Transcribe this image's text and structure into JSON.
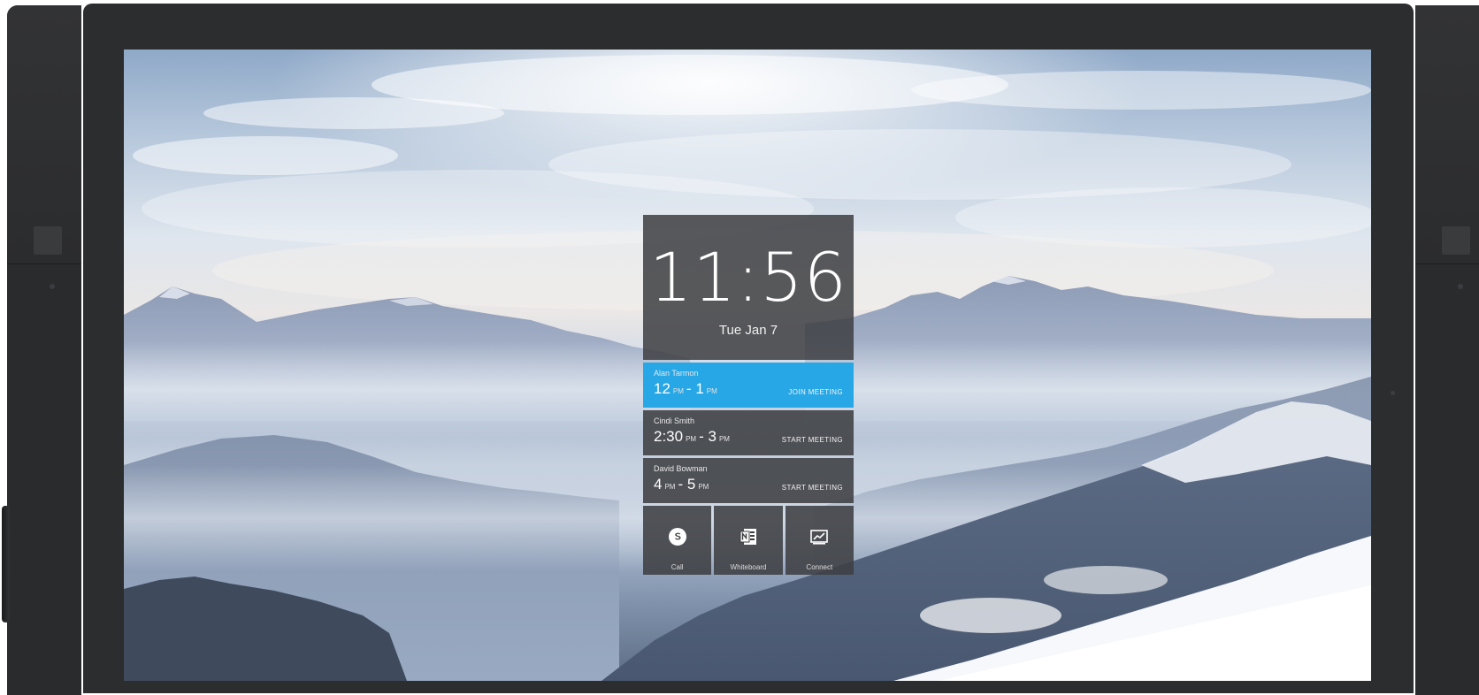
{
  "lockscreen": {
    "time": "11:56",
    "date": "Tue Jan 7"
  },
  "meetings": [
    {
      "organizer": "Alan Tarmon",
      "start": "12",
      "start_period": "PM",
      "separator": "-",
      "end": "1",
      "end_period": "PM",
      "action": "JOIN MEETING",
      "active": true
    },
    {
      "organizer": "Cindi Smith",
      "start": "2:30",
      "start_period": "PM",
      "separator": "-",
      "end": "3",
      "end_period": "PM",
      "action": "START MEETING",
      "active": false
    },
    {
      "organizer": "David Bowman",
      "start": "4",
      "start_period": "PM",
      "separator": "-",
      "end": "5",
      "end_period": "PM",
      "action": "START MEETING",
      "active": false
    }
  ],
  "apps": [
    {
      "label": "Call",
      "icon": "skype-icon"
    },
    {
      "label": "Whiteboard",
      "icon": "onenote-icon"
    },
    {
      "label": "Connect",
      "icon": "connect-icon"
    }
  ],
  "colors": {
    "accent": "#27a7e6",
    "tile": "#3e3f42",
    "bezel": "#2c2d2f"
  }
}
